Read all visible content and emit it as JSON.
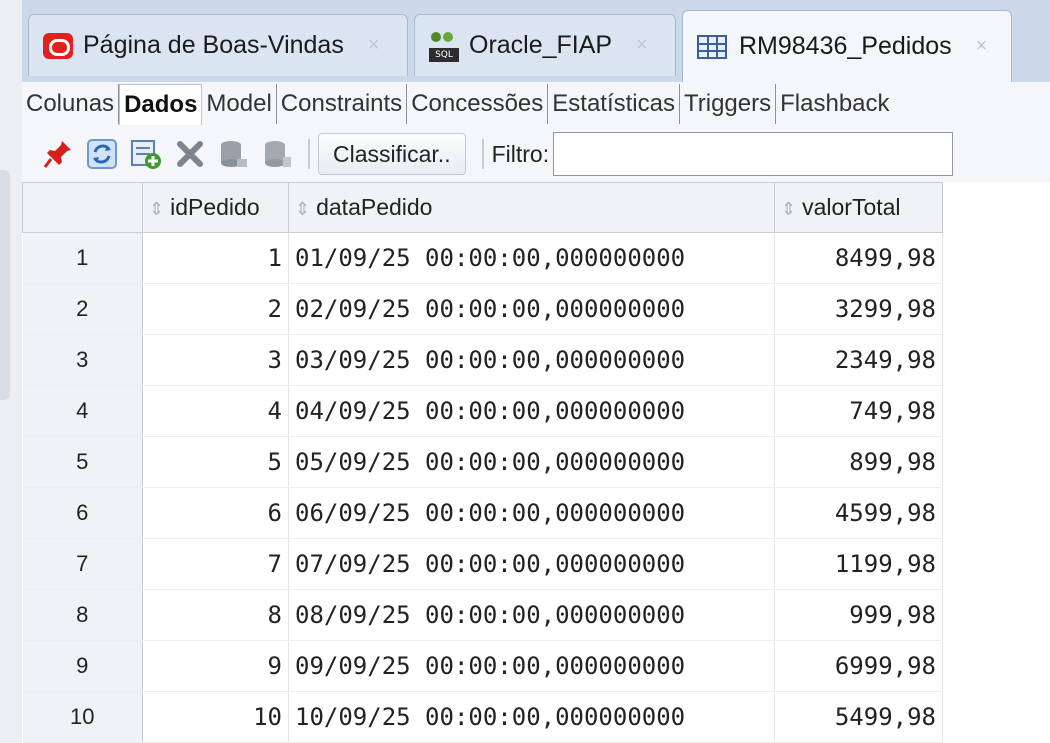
{
  "tabs": [
    {
      "label": "Página de Boas-Vindas",
      "icon": "oracle-icon",
      "active": false
    },
    {
      "label": "Oracle_FIAP",
      "icon": "sql-connection-icon",
      "active": false
    },
    {
      "label": "RM98436_Pedidos",
      "icon": "table-icon",
      "active": true
    }
  ],
  "subtabs": [
    "Colunas",
    "Dados",
    "Model",
    "Constraints",
    "Concessões",
    "Estatísticas",
    "Triggers",
    "Flashback"
  ],
  "active_subtab": "Dados",
  "toolbar": {
    "icons": [
      "pin-icon",
      "refresh-icon",
      "insert-row-icon",
      "delete-row-icon",
      "commit-icon",
      "rollback-icon"
    ],
    "sort_label": "Classificar..",
    "filter_label": "Filtro:",
    "filter_value": ""
  },
  "table": {
    "columns": [
      "idPedido",
      "dataPedido",
      "valorTotal"
    ],
    "rows": [
      {
        "rownum": "1",
        "idPedido": "1",
        "dataPedido": "01/09/25 00:00:00,000000000",
        "valorTotal": "8499,98"
      },
      {
        "rownum": "2",
        "idPedido": "2",
        "dataPedido": "02/09/25 00:00:00,000000000",
        "valorTotal": "3299,98"
      },
      {
        "rownum": "3",
        "idPedido": "3",
        "dataPedido": "03/09/25 00:00:00,000000000",
        "valorTotal": "2349,98"
      },
      {
        "rownum": "4",
        "idPedido": "4",
        "dataPedido": "04/09/25 00:00:00,000000000",
        "valorTotal": "749,98"
      },
      {
        "rownum": "5",
        "idPedido": "5",
        "dataPedido": "05/09/25 00:00:00,000000000",
        "valorTotal": "899,98"
      },
      {
        "rownum": "6",
        "idPedido": "6",
        "dataPedido": "06/09/25 00:00:00,000000000",
        "valorTotal": "4599,98"
      },
      {
        "rownum": "7",
        "idPedido": "7",
        "dataPedido": "07/09/25 00:00:00,000000000",
        "valorTotal": "1199,98"
      },
      {
        "rownum": "8",
        "idPedido": "8",
        "dataPedido": "08/09/25 00:00:00,000000000",
        "valorTotal": "999,98"
      },
      {
        "rownum": "9",
        "idPedido": "9",
        "dataPedido": "09/09/25 00:00:00,000000000",
        "valorTotal": "6999,98"
      },
      {
        "rownum": "10",
        "idPedido": "10",
        "dataPedido": "10/09/25 00:00:00,000000000",
        "valorTotal": "5499,98"
      }
    ]
  },
  "colors": {
    "tabbar": "#cbd8ea",
    "oracle_red": "#e3201b",
    "grid_header": "#f0f2f5"
  }
}
